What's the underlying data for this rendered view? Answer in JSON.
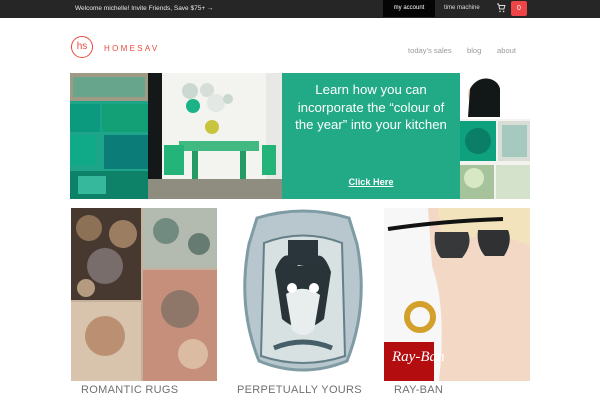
{
  "topbar": {
    "welcome": "Welcome michelle! Invite Friends, Save $75+ →",
    "my_account": "my account",
    "time_machine": "time machine",
    "cart_count": "0",
    "cart_icon": "shopping-cart-icon"
  },
  "header": {
    "logo_mark": "hs",
    "brand": "HOMESAV",
    "nav": [
      "today's sales",
      "blog",
      "about"
    ]
  },
  "hero": {
    "headline": "Learn how you can incorporate the “colour of the year” into your kitchen",
    "link": "Click Here",
    "accent_color": "#22aa86"
  },
  "products": [
    {
      "caption": "ROMANTIC RUGS"
    },
    {
      "caption": "PERPETUALLY YOURS"
    },
    {
      "caption": "RAY-BAN",
      "brand_badge": "Ray-Ban"
    }
  ]
}
